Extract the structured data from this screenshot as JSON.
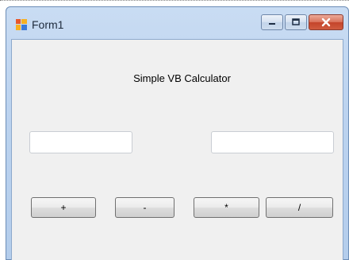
{
  "window": {
    "title": "Form1",
    "icon": "winforms-app-icon"
  },
  "caption_buttons": {
    "minimize": "minimize-icon",
    "maximize": "maximize-icon",
    "close": "close-icon"
  },
  "form": {
    "heading": "Simple VB Calculator",
    "textbox1_value": "",
    "textbox2_value": "",
    "buttons": {
      "add": "+",
      "subtract": "-",
      "multiply": "*",
      "divide": "/"
    }
  },
  "colors": {
    "titlebar": "#c9dcf3",
    "client": "#f0f0f0",
    "close_button": "#c4442a"
  }
}
